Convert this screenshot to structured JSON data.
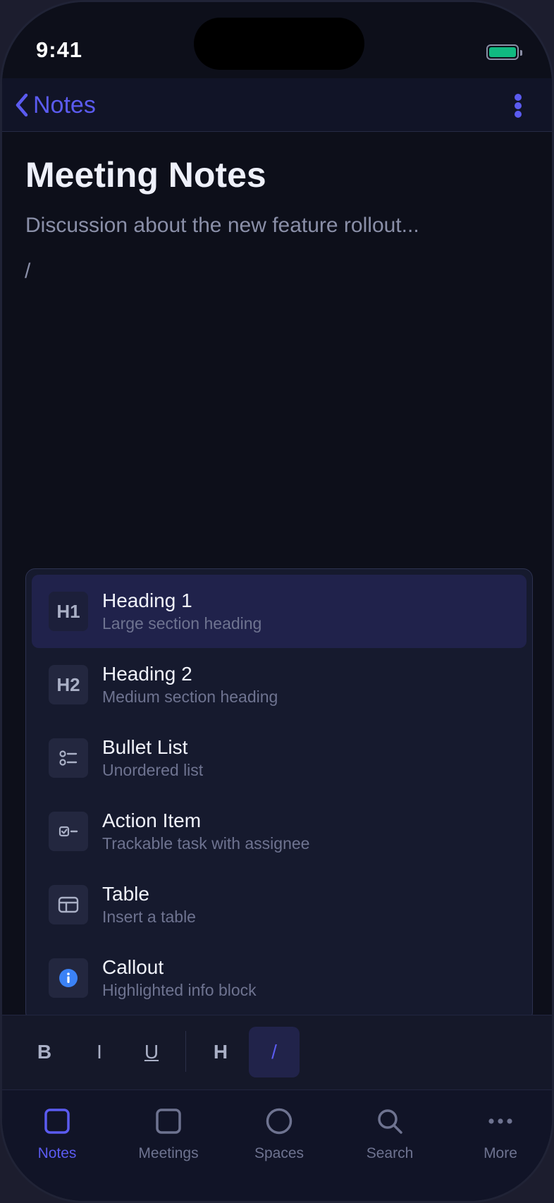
{
  "status_bar": {
    "time": "9:41"
  },
  "nav": {
    "back_label": "Notes"
  },
  "document": {
    "title": "Meeting Notes",
    "body": "Discussion about the new feature rollout...",
    "current_line": "/"
  },
  "slash_menu": {
    "items": [
      {
        "icon": "H1",
        "label": "Heading 1",
        "description": "Large section heading"
      },
      {
        "icon": "H2",
        "label": "Heading 2",
        "description": "Medium section heading"
      },
      {
        "icon": "bullet-list-icon",
        "label": "Bullet List",
        "description": "Unordered list"
      },
      {
        "icon": "checkbox-icon",
        "label": "Action Item",
        "description": "Trackable task with assignee"
      },
      {
        "icon": "table-icon",
        "label": "Table",
        "description": "Insert a table"
      },
      {
        "icon": "info-icon",
        "label": "Callout",
        "description": "Highlighted info block"
      }
    ]
  },
  "toolbar": {
    "bold": "B",
    "italic": "I",
    "underline": "U",
    "heading": "H",
    "slash": "/"
  },
  "tabs": [
    {
      "label": "Notes"
    },
    {
      "label": "Meetings"
    },
    {
      "label": "Spaces"
    },
    {
      "label": "Search"
    },
    {
      "label": "More"
    }
  ],
  "colors": {
    "accent": "#5b5bf0",
    "background": "#0d0f1a",
    "battery": "#10b981",
    "info": "#3b82f6"
  }
}
